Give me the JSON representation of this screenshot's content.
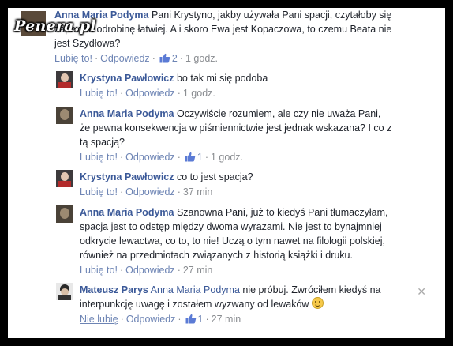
{
  "watermark": "Penera.pl",
  "ui": {
    "like": "Lubię to!",
    "reply": "Odpowiedz",
    "separator": "·",
    "unlike": "Nie lubię"
  },
  "comments": [
    {
      "author": "Anna Maria Podyma",
      "text_lines": [
        "Pani Krystyno, jakby używała Pani spacji, czytałoby się",
        "zapewne odrobinę łatwiej. A i skoro Ewa jest Kopaczowa, to czemu Beata nie",
        "jest Szydłowa?"
      ],
      "likes": "2",
      "time": "1 godz."
    },
    {
      "author": "Krystyna Pawłowicz",
      "text_lines": [
        "bo tak mi się podoba"
      ],
      "likes": "",
      "time": "1 godz."
    },
    {
      "author": "Anna Maria Podyma",
      "text_lines": [
        "Oczywiście rozumiem, ale czy nie uważa Pani,",
        "że pewna konsekwencja w piśmiennictwie jest jednak wskazana? I co z",
        "tą spacją?"
      ],
      "likes": "1",
      "time": "1 godz."
    },
    {
      "author": "Krystyna Pawłowicz",
      "text_lines": [
        "co to jest spacja?"
      ],
      "likes": "",
      "time": "37 min"
    },
    {
      "author": "Anna Maria Podyma",
      "text_lines": [
        "Szanowna Pani, już to kiedyś Pani tłumaczyłam,",
        "spacja jest to odstęp między dwoma wyrazami. Nie jest to bynajmniej",
        "odkrycie lewactwa, co to, to nie! Uczą o tym nawet na filologii polskiej,",
        "również na przedmiotach związanych z historią książki i druku."
      ],
      "likes": "",
      "time": "27 min"
    },
    {
      "author": "Mateusz Parys",
      "mention": "Anna Maria Podyma",
      "text_lines": [
        "nie próbuj. Zwróciłem kiedyś na",
        "interpunkcję uwagę i zostałem wyzwany od lewaków"
      ],
      "likes": "1",
      "time": "27 min",
      "close": "✕"
    }
  ]
}
